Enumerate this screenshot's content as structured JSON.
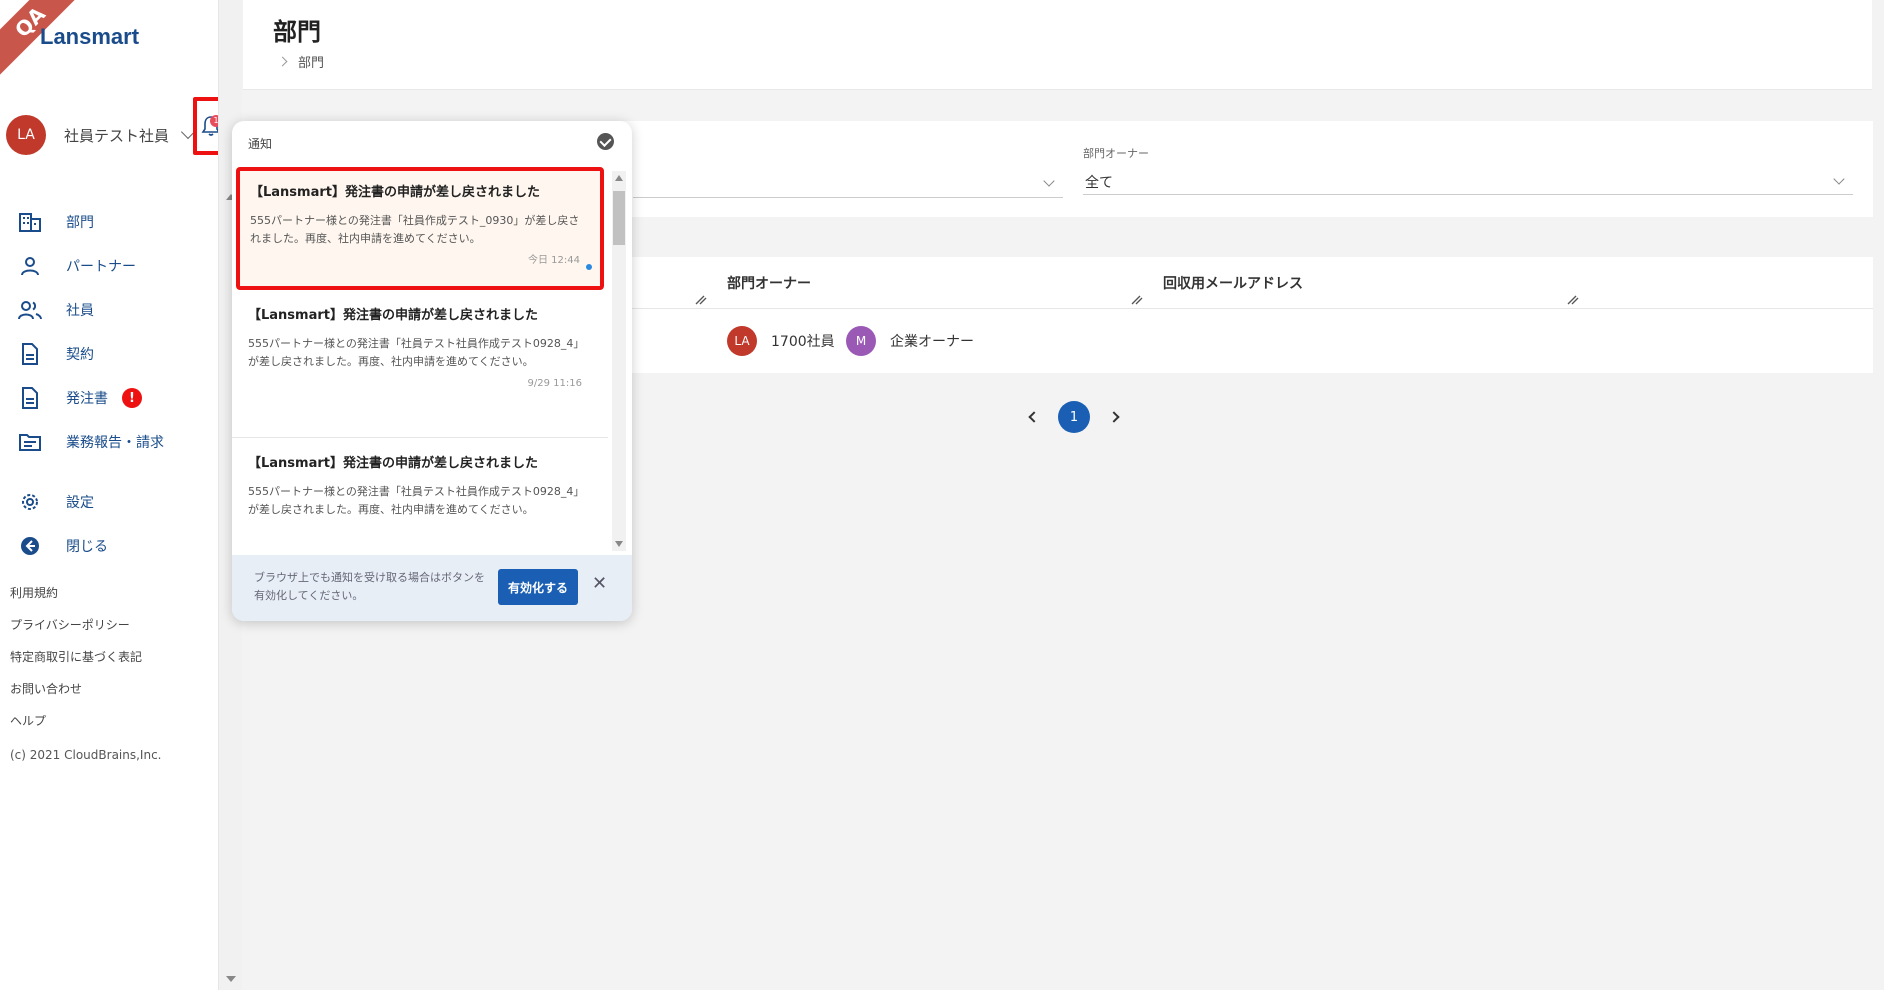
{
  "app": {
    "ribbon": "QA",
    "logo": "Lansmart"
  },
  "user": {
    "initials": "LA",
    "name": "社員テスト社員",
    "bell_count": "1"
  },
  "nav": {
    "items": [
      {
        "label": "部門"
      },
      {
        "label": "パートナー"
      },
      {
        "label": "社員"
      },
      {
        "label": "契約"
      },
      {
        "label": "発注書",
        "badge": "!"
      },
      {
        "label": "業務報告・請求"
      },
      {
        "label": "設定"
      },
      {
        "label": "閉じる"
      }
    ]
  },
  "footer": {
    "links": [
      "利用規約",
      "プライバシーポリシー",
      "特定商取引に基づく表記",
      "お問い合わせ",
      "ヘルプ"
    ],
    "copyright": "(c) 2021 CloudBrains,Inc."
  },
  "header": {
    "title": "部門",
    "breadcrumb": "部門"
  },
  "filters": {
    "owner_label": "部門オーナー",
    "owner_value": "全て"
  },
  "table": {
    "headers": [
      "部門オーナー",
      "回収用メールアドレス"
    ],
    "row": {
      "owners": [
        {
          "initials": "LA",
          "name": "1700社員",
          "color": "#c0392b"
        },
        {
          "initials": "M",
          "name": "企業オーナー",
          "color": "#9b59b6"
        }
      ]
    }
  },
  "pagination": {
    "current": "1"
  },
  "notifications": {
    "heading": "通知",
    "items": [
      {
        "title": "【Lansmart】発注書の申請が差し戻されました",
        "body": "555パートナー様との発注書「社員作成テスト_0930」が差し戻されました。再度、社内申請を進めてください。",
        "time": "今日 12:44"
      },
      {
        "title": "【Lansmart】発注書の申請が差し戻されました",
        "body": "555パートナー様との発注書「社員テスト社員作成テスト0928_4」が差し戻されました。再度、社内申請を進めてください。",
        "time": "9/29 11:16"
      },
      {
        "title": "【Lansmart】発注書の申請が差し戻されました",
        "body": "555パートナー様との発注書「社員テスト社員作成テスト0928_4」が差し戻されました。再度、社内申請を進めてください。",
        "time": ""
      }
    ],
    "footer_text": "ブラウザ上でも通知を受け取る場合はボタンを有効化してください。",
    "enable_button": "有効化する",
    "close_symbol": "✕"
  },
  "colors": {
    "brand": "#1a4c8b",
    "primary": "#1a5fb4",
    "alert": "#e11111"
  }
}
